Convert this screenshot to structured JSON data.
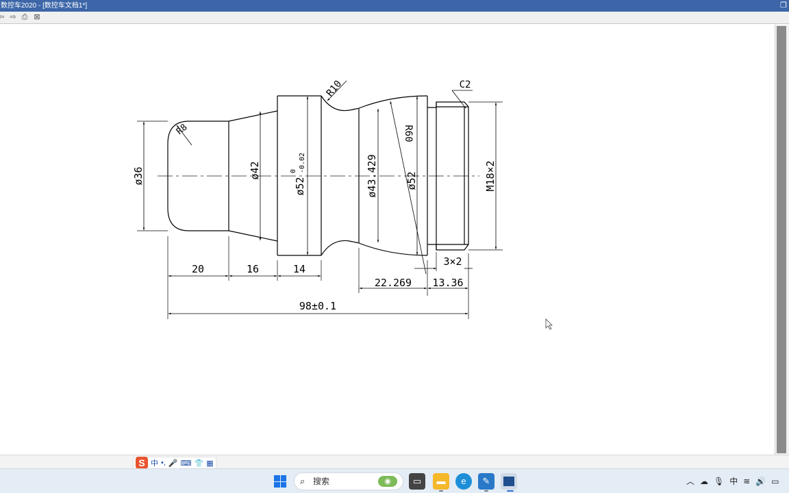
{
  "window": {
    "title": "数控车2020 - [数控车文档1*]",
    "maximize_glyph": "❐"
  },
  "toolbar": {
    "tools": [
      {
        "icon": "undo-arrow-icon",
        "glyph": "⇦"
      },
      {
        "icon": "redo-arrow-icon",
        "glyph": "⇨"
      },
      {
        "icon": "print-icon",
        "glyph": "⎙"
      },
      {
        "icon": "delete-icon",
        "glyph": "⊠"
      }
    ]
  },
  "drawing": {
    "dimensions": {
      "d36": "ø36",
      "d42": "ø42",
      "d52_tol_main": "ø52",
      "d52_tol_upper": "0",
      "d52_tol_lower": "-0.02",
      "d43": "ø43.429",
      "d52": "ø52",
      "m18": "M18×2",
      "r8": "R8",
      "r10": "R10",
      "r60": "R60",
      "c2": "C2",
      "groove": "3×2",
      "len20": "20",
      "len16": "16",
      "len14": "14",
      "len22": "22.269",
      "len13": "13.36",
      "total": "98±0.1"
    },
    "colors": {
      "line": "#000000",
      "centerline": "#555555"
    }
  },
  "ime": {
    "logo": "S",
    "mode": "中",
    "punct": "•,",
    "icons": [
      "mic-icon",
      "keyboard-icon",
      "skin-icon",
      "toolbox-icon"
    ]
  },
  "taskbar": {
    "search_placeholder": "搜索",
    "apps": [
      "file-explorer",
      "folder",
      "edge-browser",
      "drawing-app",
      "cad-app"
    ],
    "tray_icons": [
      "chevron-up-icon",
      "cloud-icon",
      "mic-icon",
      "input-icon",
      "wifi-icon",
      "speaker-icon",
      "battery-icon"
    ]
  }
}
